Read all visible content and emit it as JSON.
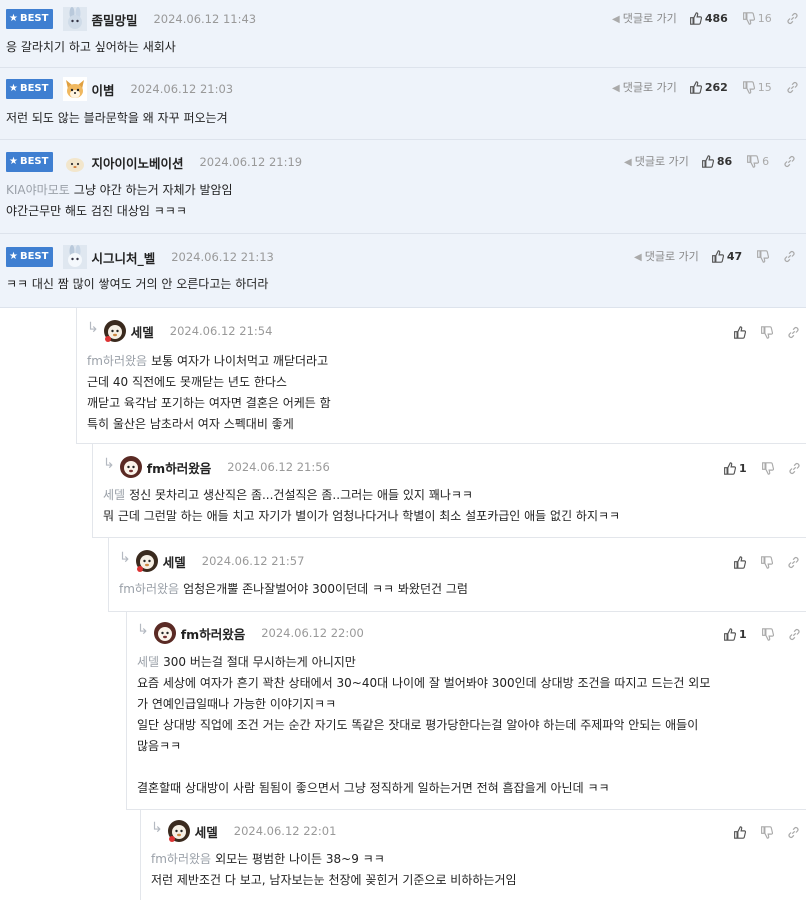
{
  "best_label": "BEST",
  "reply_to_label": "댓글로 가기",
  "comments": [
    {
      "nick": "좀밀망밀",
      "date": "2024.06.12 11:43",
      "mention": "",
      "lines": [
        "응 갈라치기 하고 싶어하는 새회사"
      ],
      "upvotes": "486",
      "downvotes": "16",
      "avatar_icon": "rabbit-avatar-icon"
    },
    {
      "nick": "이볌",
      "date": "2024.06.12 21:03",
      "mention": "",
      "lines": [
        "저런 되도 않는 블라문학을 왜 자꾸 퍼오는겨"
      ],
      "upvotes": "262",
      "downvotes": "15",
      "avatar_icon": "shiba-avatar-icon"
    },
    {
      "nick": "지아이이노베이션",
      "date": "2024.06.12 21:19",
      "mention": "KIA야마모토",
      "lines": [
        "그냥 야간 하는거 자체가 발암임",
        "야간근무만 해도 검진 대상임 ㅋㅋㅋ"
      ],
      "upvotes": "86",
      "downvotes": "6",
      "avatar_icon": "chick-avatar-icon"
    },
    {
      "nick": "시그니처_벨",
      "date": "2024.06.12 21:13",
      "mention": "",
      "lines": [
        "ㅋㅋ 대신 짬 많이 쌓여도 거의 안 오른다고는 하더라"
      ],
      "upvotes": "47",
      "downvotes": "",
      "avatar_icon": "rabbit-avatar-icon"
    }
  ],
  "replies": [
    {
      "nick": "세델",
      "date": "2024.06.12 21:54",
      "mention": "fm하러왔음",
      "lines": [
        "보통 여자가 나이처먹고 깨닫더라고",
        "근데 40 직전에도 못깨닫는 년도 한다스",
        "깨닫고 육각남 포기하는 여자면 결혼은 어케든 함",
        "특히 울산은 남초라서 여자 스펙대비 좋게"
      ],
      "upvotes": "",
      "avatar_icon": "lion-avatar-icon"
    },
    {
      "nick": "fm하러왔음",
      "date": "2024.06.12 21:56",
      "mention": "세델",
      "lines": [
        "정신 못차리고 생산직은 좀...건설직은 좀..그러는 애들 있지 꽤나ㅋㅋ",
        "뭐 근데 그런말 하는 애들 치고 자기가 별이가 엄청나다거나 학별이 최소 설포카급인 애들 없긴 하지ㅋㅋ"
      ],
      "upvotes": "1",
      "avatar_icon": "dog-avatar-icon"
    },
    {
      "nick": "세델",
      "date": "2024.06.12 21:57",
      "mention": "fm하러왔음",
      "lines": [
        "엄청은개뿔 존나잘벌어야 300이던데 ㅋㅋ 봐왔던건 그럼"
      ],
      "upvotes": "",
      "avatar_icon": "lion-avatar-icon"
    },
    {
      "nick": "fm하러왔음",
      "date": "2024.06.12 22:00",
      "mention": "세델",
      "lines": [
        "300 버는걸 절대 무시하는게 아니지만",
        "요즘 세상에 여자가 흔기 꽉찬 상태에서 30~40대 나이에 잘 벌어봐야 300인데 상대방 조건을 따지고 드는건 외모",
        "가 연예인급일때나 가능한 이야기지ㅋㅋ",
        "일단 상대방 직업에 조건 거는 순간 자기도 똑같은 잣대로 평가당한다는걸 알아야 하는데 주제파악 안되는 애들이",
        "많음ㅋㅋ",
        "",
        "결혼할때 상대방이 사람 됨됨이 좋으면서 그냥 정직하게 일하는거면 전혀 흠잡을게 아닌데 ㅋㅋ"
      ],
      "upvotes": "1",
      "avatar_icon": "dog-avatar-icon"
    },
    {
      "nick": "세델",
      "date": "2024.06.12 22:01",
      "mention": "fm하러왔음",
      "lines": [
        "외모는 평범한 나이든 38~9 ㅋㅋ",
        "저런 제반조건 다 보고, 남자보는눈 천장에 꽂힌거 기준으로 비하하는거임"
      ],
      "upvotes": "",
      "avatar_icon": "lion-avatar-icon"
    }
  ],
  "colors": {
    "best_bg": "#eef3fa",
    "badge": "#3f7fd1",
    "mention": "#9aa0a8",
    "date": "#999999"
  }
}
